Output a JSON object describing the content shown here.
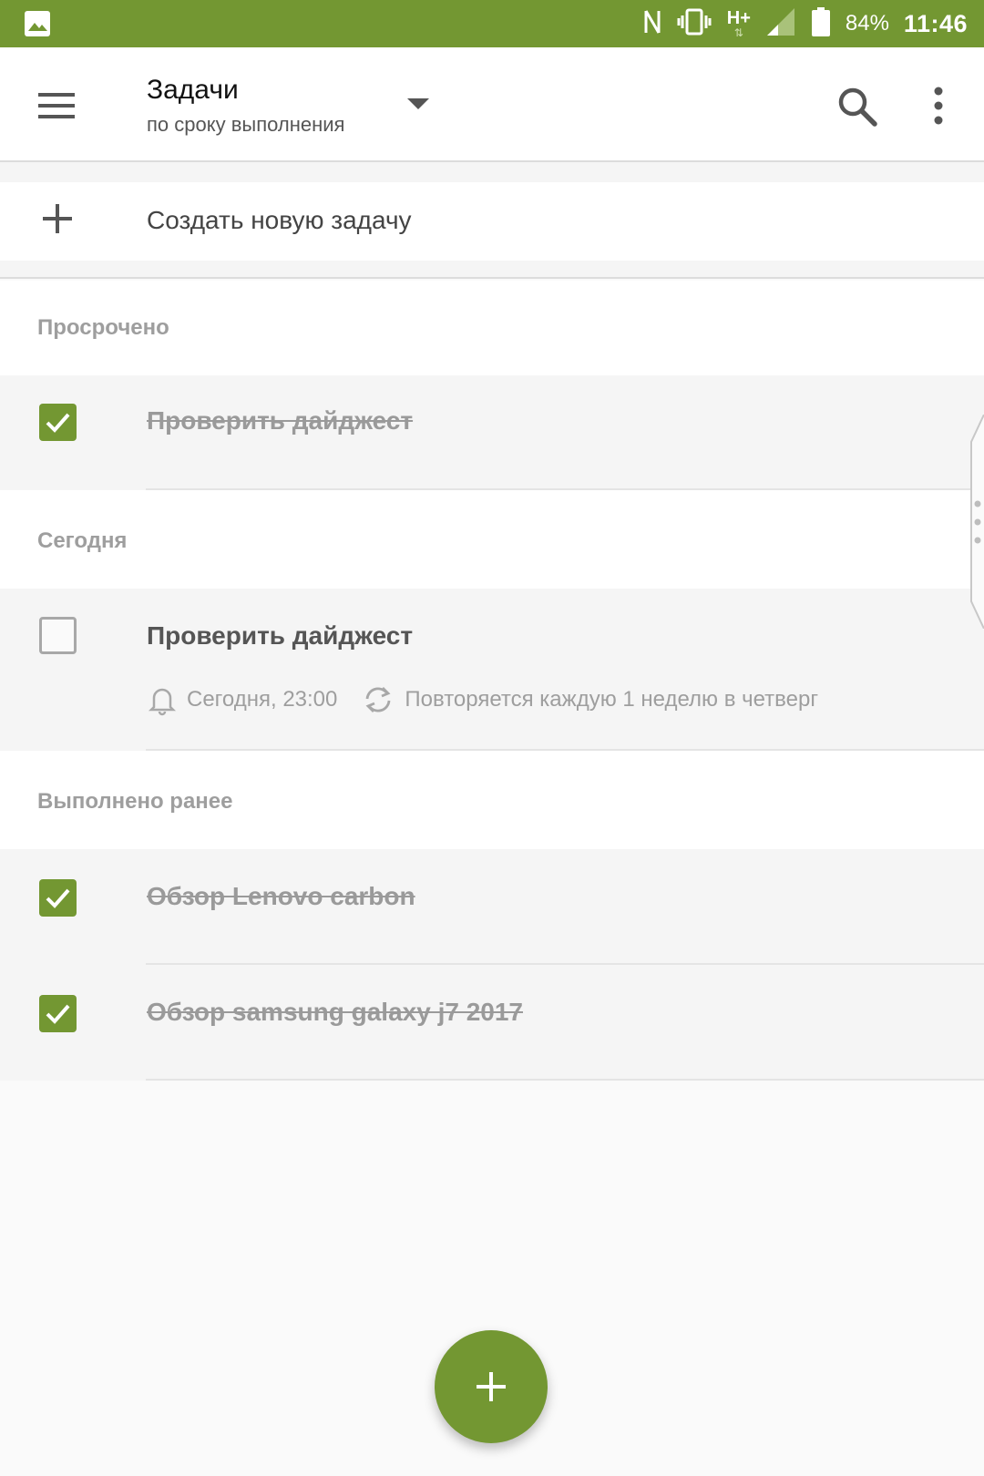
{
  "status_bar": {
    "battery": "84%",
    "time": "11:46",
    "network": "H+",
    "icons": [
      "image-icon",
      "nfc-icon",
      "vibrate-icon",
      "signal-icon",
      "battery-icon"
    ]
  },
  "app_bar": {
    "title": "Задачи",
    "subtitle": "по сроку выполнения",
    "icons": [
      "menu-icon",
      "dropdown-arrow-icon",
      "search-icon",
      "more-vert-icon"
    ]
  },
  "create_task": {
    "label": "Создать новую задачу"
  },
  "sections": [
    {
      "header": "Просрочено",
      "tasks": [
        {
          "title": "Проверить дайджест",
          "done": true
        }
      ]
    },
    {
      "header": "Сегодня",
      "tasks": [
        {
          "title": "Проверить дайджест",
          "done": false,
          "reminder": "Сегодня, 23:00",
          "repeat": "Повторяется каждую 1 неделю в четверг"
        }
      ]
    },
    {
      "header": "Выполнено ранее",
      "tasks": [
        {
          "title": "Обзор Lenovo carbon",
          "done": true
        },
        {
          "title": "Обзор samsung galaxy j7 2017",
          "done": true
        }
      ]
    }
  ],
  "colors": {
    "accent": "#739732",
    "section_text": "#9e9e9e",
    "background": "#fafafa"
  }
}
